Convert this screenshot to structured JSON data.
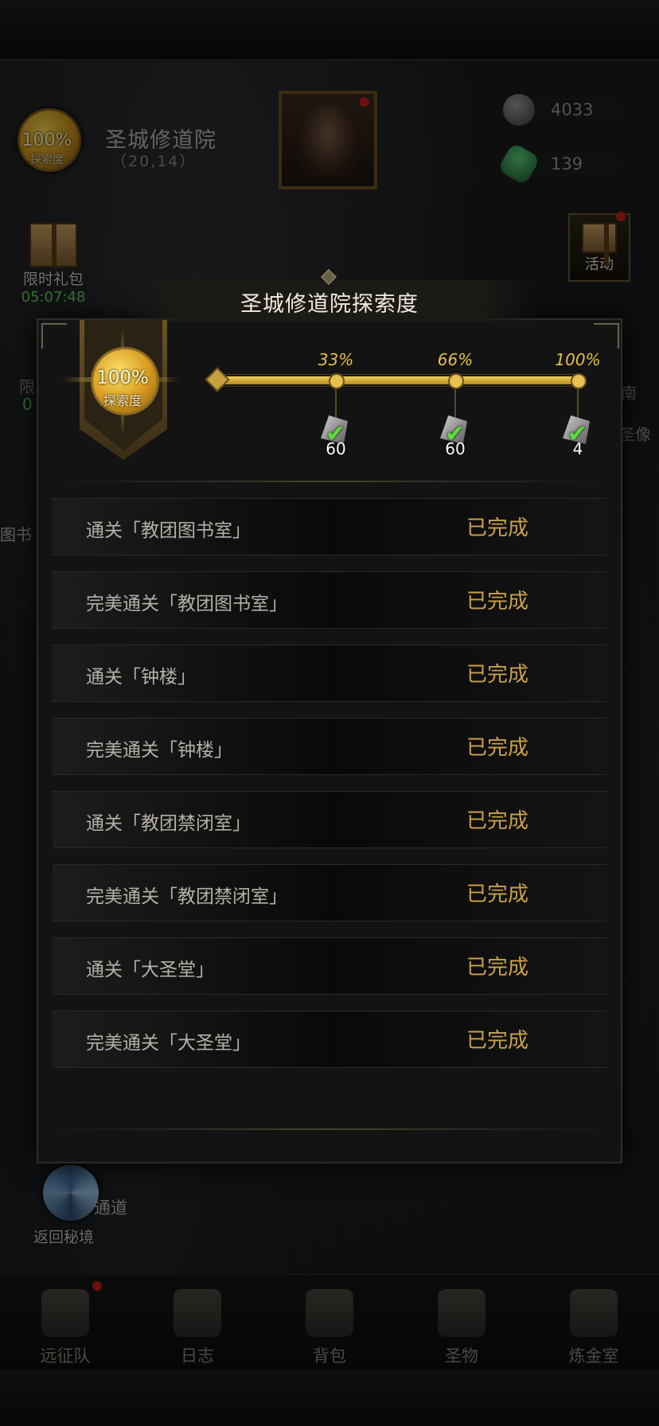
{
  "hud": {
    "exploration_percent": "100%",
    "exploration_label": "探索度",
    "location_name": "圣城修道院",
    "location_coords": "（20,14）",
    "currency_silver": "4033",
    "currency_gem": "139",
    "gift_label": "限时礼包",
    "gift_timer": "05:07:48",
    "event_label": "活动",
    "partial_left_1": "限",
    "partial_left_2": "0",
    "partial_left_3": "图书",
    "partial_right_1": "南",
    "partial_right_2": "圣像",
    "portal_label": "通道",
    "portal_return": "返回秘境"
  },
  "modal": {
    "title": "圣城修道院探索度",
    "total_percent": "100%",
    "total_label": "探索度",
    "progress": 1.0,
    "milestones": [
      {
        "percent": "33%",
        "count": "60"
      },
      {
        "percent": "66%",
        "count": "60"
      },
      {
        "percent": "100%",
        "count": "4"
      }
    ],
    "tasks": [
      {
        "name": "通关「教团图书室」",
        "status": "已完成"
      },
      {
        "name": "完美通关「教团图书室」",
        "status": "已完成"
      },
      {
        "name": "通关「钟楼」",
        "status": "已完成"
      },
      {
        "name": "完美通关「钟楼」",
        "status": "已完成"
      },
      {
        "name": "通关「教团禁闭室」",
        "status": "已完成"
      },
      {
        "name": "完美通关「教团禁闭室」",
        "status": "已完成"
      },
      {
        "name": "通关「大圣堂」",
        "status": "已完成"
      },
      {
        "name": "完美通关「大圣堂」",
        "status": "已完成"
      }
    ]
  },
  "nav": {
    "items": [
      "远征队",
      "日志",
      "背包",
      "圣物",
      "炼金室"
    ]
  },
  "colors": {
    "accent_gold": "#c9a24a",
    "progress_gold": "#e8c040",
    "check_green": "#5adc3a",
    "timer_green": "#5ed05a",
    "notify_red": "#c0201a"
  }
}
